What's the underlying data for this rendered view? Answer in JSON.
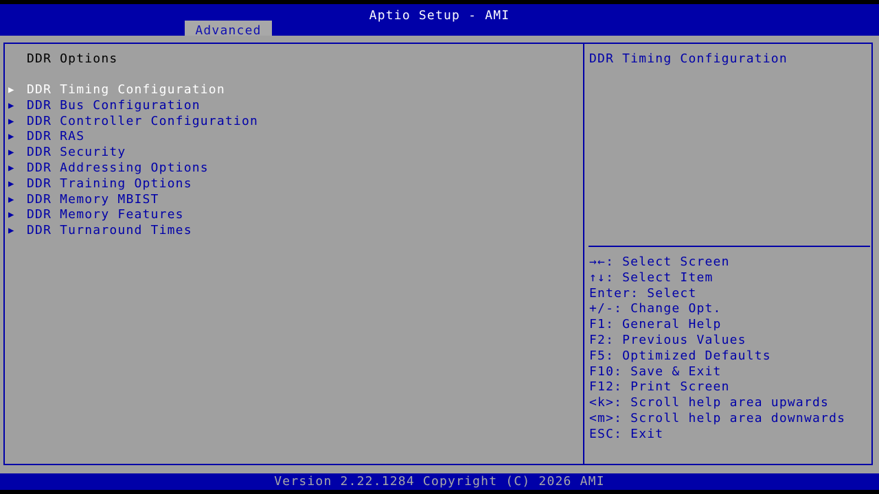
{
  "header": {
    "title": "Aptio Setup - AMI",
    "active_tab": "Advanced"
  },
  "left_panel": {
    "section_title": "DDR Options",
    "arrow_icon": "▶",
    "items": [
      {
        "label": "DDR Timing Configuration",
        "selected": true
      },
      {
        "label": "DDR Bus Configuration",
        "selected": false
      },
      {
        "label": "DDR Controller Configuration",
        "selected": false
      },
      {
        "label": "DDR RAS",
        "selected": false
      },
      {
        "label": "DDR Security",
        "selected": false
      },
      {
        "label": "DDR Addressing Options",
        "selected": false
      },
      {
        "label": "DDR Training Options",
        "selected": false
      },
      {
        "label": "DDR Memory MBIST",
        "selected": false
      },
      {
        "label": "DDR Memory Features",
        "selected": false
      },
      {
        "label": "DDR Turnaround Times",
        "selected": false
      }
    ]
  },
  "right_panel": {
    "help_text": "DDR Timing Configuration",
    "keys": [
      "→←: Select Screen",
      "↑↓: Select Item",
      "Enter: Select",
      "+/-: Change Opt.",
      "F1: General Help",
      "F2: Previous Values",
      "F5: Optimized Defaults",
      "F10: Save & Exit",
      "F12: Print Screen",
      "<k>: Scroll help area upwards",
      "<m>: Scroll help area downwards",
      "ESC: Exit"
    ]
  },
  "footer": {
    "version": "Version 2.22.1284 Copyright (C) 2026 AMI"
  },
  "colors": {
    "bar_blue": "#0000a8",
    "panel_gray": "#a0a0a0",
    "text_blue": "#0000a8",
    "selected_text": "#ffffff"
  }
}
